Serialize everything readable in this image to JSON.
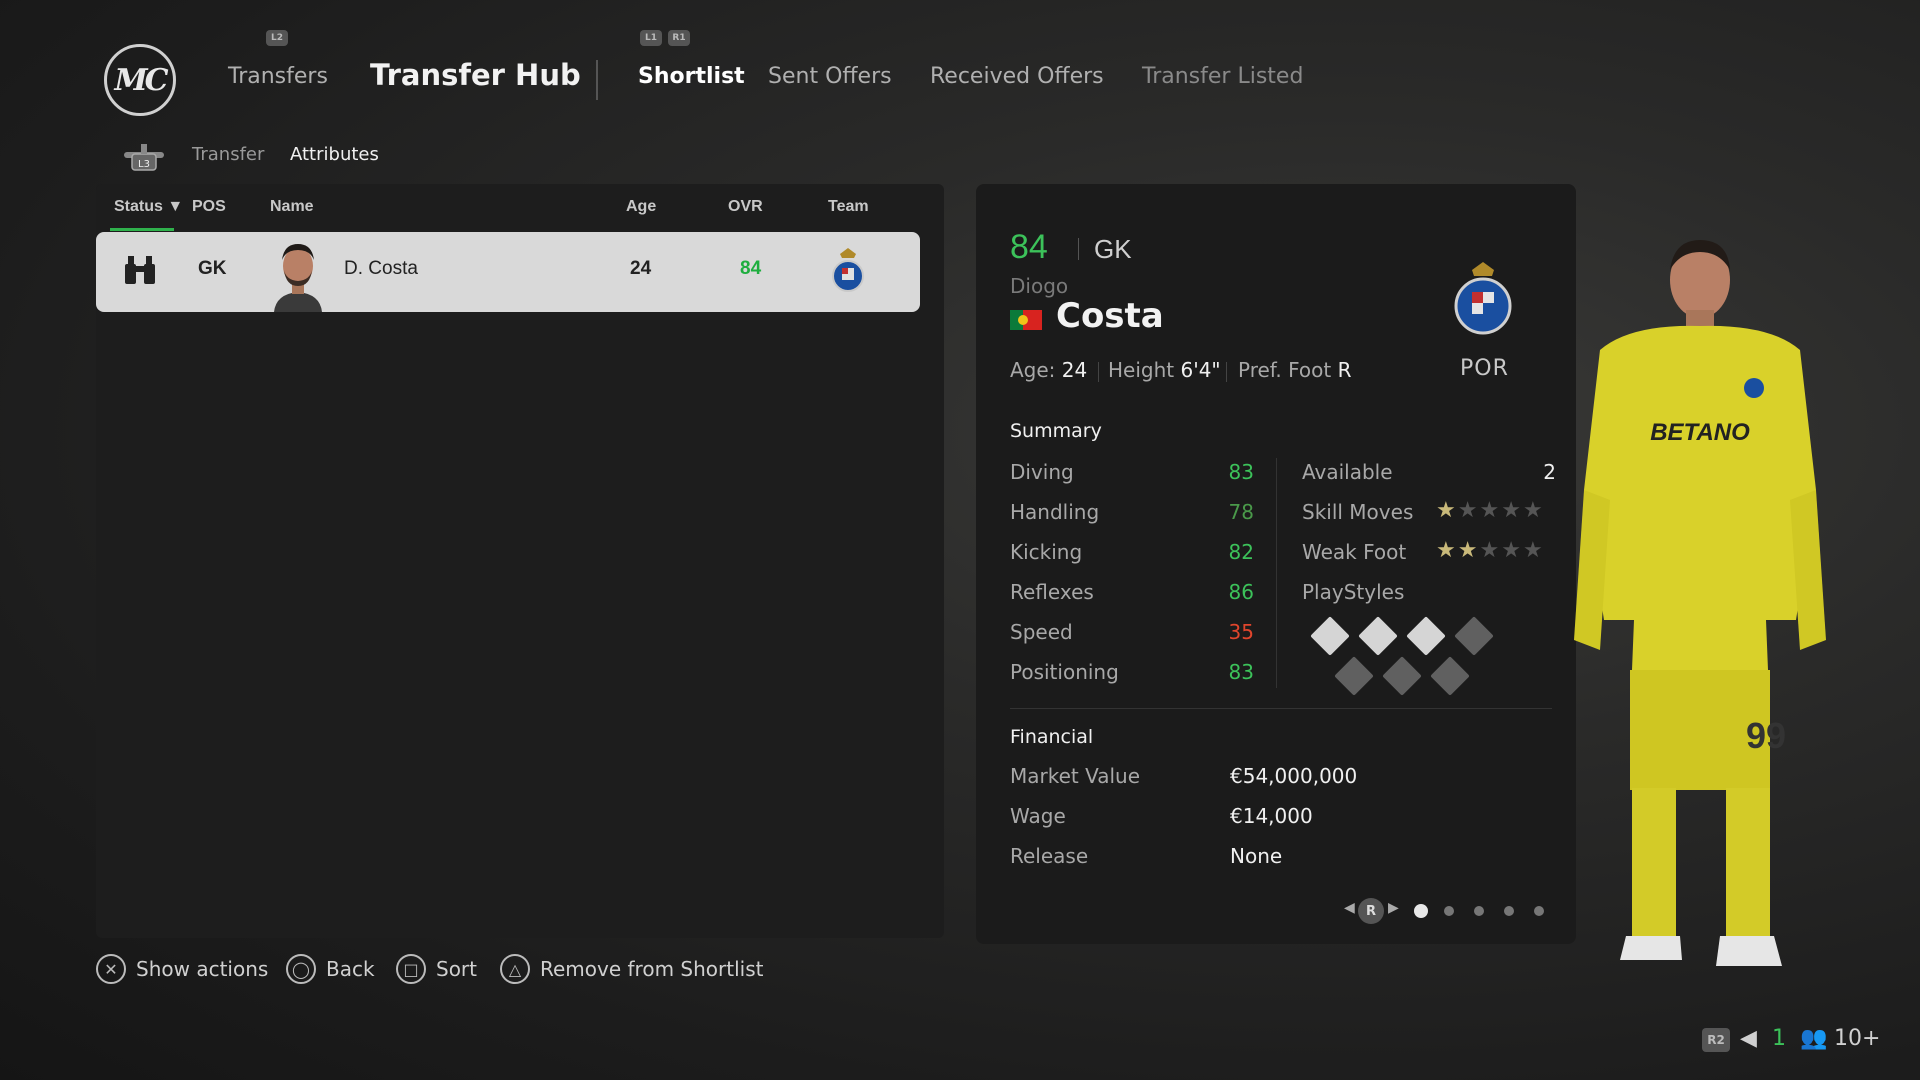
{
  "nav": {
    "logo": "MC",
    "l2_hint": "L2",
    "l1_hint": "L1",
    "r1_hint": "R1",
    "transfers": "Transfers",
    "transfer_hub": "Transfer Hub",
    "tabs": [
      "Shortlist",
      "Sent Offers",
      "Received Offers",
      "Transfer Listed"
    ]
  },
  "subnav": {
    "l3_hint": "L3",
    "transfer": "Transfer",
    "attributes": "Attributes"
  },
  "table": {
    "headers": {
      "status": "Status",
      "pos": "POS",
      "name": "Name",
      "age": "Age",
      "ovr": "OVR",
      "team": "Team"
    },
    "rows": [
      {
        "pos": "GK",
        "name": "D. Costa",
        "age": "24",
        "ovr": "84"
      }
    ]
  },
  "player": {
    "ovr": "84",
    "pos": "GK",
    "first_name": "Diogo",
    "last_name": "Costa",
    "age_label": "Age:",
    "age": "24",
    "height_label": "Height",
    "height": "6'4\"",
    "foot_label": "Pref. Foot",
    "foot": "R",
    "nation": "POR"
  },
  "summary": {
    "title": "Summary",
    "stats": [
      {
        "label": "Diving",
        "value": "83",
        "color": "#3cc25a"
      },
      {
        "label": "Handling",
        "value": "78",
        "color": "#4a9a4a"
      },
      {
        "label": "Kicking",
        "value": "82",
        "color": "#3cc25a"
      },
      {
        "label": "Reflexes",
        "value": "86",
        "color": "#3cc25a"
      },
      {
        "label": "Speed",
        "value": "35",
        "color": "#e0452c"
      },
      {
        "label": "Positioning",
        "value": "83",
        "color": "#3cc25a"
      }
    ],
    "available_label": "Available",
    "available_value": "2",
    "skill_moves_label": "Skill Moves",
    "skill_moves_stars": 1,
    "weak_foot_label": "Weak Foot",
    "weak_foot_stars": 2,
    "playstyles_label": "PlayStyles"
  },
  "financial": {
    "title": "Financial",
    "market_value_label": "Market Value",
    "market_value": "€54,000,000",
    "wage_label": "Wage",
    "wage": "€14,000",
    "release_label": "Release",
    "release": "None"
  },
  "pager": {
    "hint": "R",
    "current_page": 1,
    "total_pages": 5
  },
  "actions": [
    {
      "icon": "cross-button-icon",
      "glyph": "✕",
      "label": "Show actions"
    },
    {
      "icon": "circle-button-icon",
      "glyph": "◯",
      "label": "Back"
    },
    {
      "icon": "square-button-icon",
      "glyph": "□",
      "label": "Sort"
    },
    {
      "icon": "triangle-button-icon",
      "glyph": "△",
      "label": "Remove from Shortlist"
    }
  ],
  "status_bar": {
    "r2_hint": "R2",
    "voice_count": "1",
    "online_count": "10+"
  },
  "colors": {
    "accent_green": "#3cc25a",
    "low_red": "#e0452c",
    "kit_yellow": "#d9d12a"
  }
}
